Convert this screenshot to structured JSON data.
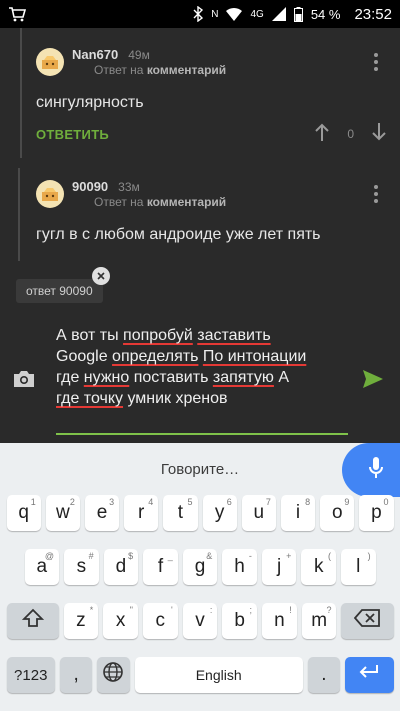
{
  "status_bar": {
    "battery_percent": "54 %",
    "time": "23:52",
    "network": "4G",
    "icons": [
      "shop-icon",
      "bluetooth-icon",
      "nfc-icon",
      "wifi-icon",
      "signal-icon",
      "battery-icon"
    ]
  },
  "comments": [
    {
      "username": "Nan670",
      "time": "49м",
      "reply_prefix": "Ответ на",
      "reply_target": "комментарий",
      "text": "сингулярность",
      "reply_label": "ОТВЕТИТЬ",
      "votes": "0"
    },
    {
      "username": "90090",
      "time": "33м",
      "reply_prefix": "Ответ на",
      "reply_target": "комментарий",
      "text": "гугл в с любом андроиде уже лет пять"
    }
  ],
  "composer": {
    "reply_chip": "ответ 90090",
    "lines": [
      [
        "А вот ты ",
        "попробуй",
        " ",
        "заставить"
      ],
      [
        "Google ",
        "определять",
        " ",
        "По интонации"
      ],
      [
        "где ",
        "нужно",
        " поставить ",
        "запятую",
        " А"
      ],
      [
        "где точку",
        " умник хренов"
      ]
    ]
  },
  "keyboard": {
    "voice_prompt": "Говорите…",
    "row1": [
      [
        "q",
        "1"
      ],
      [
        "w",
        "2"
      ],
      [
        "e",
        "3"
      ],
      [
        "r",
        "4"
      ],
      [
        "t",
        "5"
      ],
      [
        "y",
        "6"
      ],
      [
        "u",
        "7"
      ],
      [
        "i",
        "8"
      ],
      [
        "o",
        "9"
      ],
      [
        "p",
        "0"
      ]
    ],
    "row2": [
      [
        "a",
        "@"
      ],
      [
        "s",
        "#"
      ],
      [
        "d",
        "$"
      ],
      [
        "f",
        "_"
      ],
      [
        "g",
        "&"
      ],
      [
        "h",
        "-"
      ],
      [
        "j",
        "+"
      ],
      [
        "k",
        "("
      ],
      [
        "l",
        ")"
      ]
    ],
    "row3": [
      [
        "z",
        "*"
      ],
      [
        "x",
        "\""
      ],
      [
        "c",
        "'"
      ],
      [
        "v",
        ":"
      ],
      [
        "b",
        ";"
      ],
      [
        "n",
        "!"
      ],
      [
        "m",
        "?"
      ]
    ],
    "symbols_key": "?123",
    "comma": ",",
    "space_label": "English",
    "period": ".",
    "colors": {
      "accent_green": "#6fae3c",
      "keyboard_blue": "#4285f4",
      "spell_red": "#e53935"
    }
  }
}
